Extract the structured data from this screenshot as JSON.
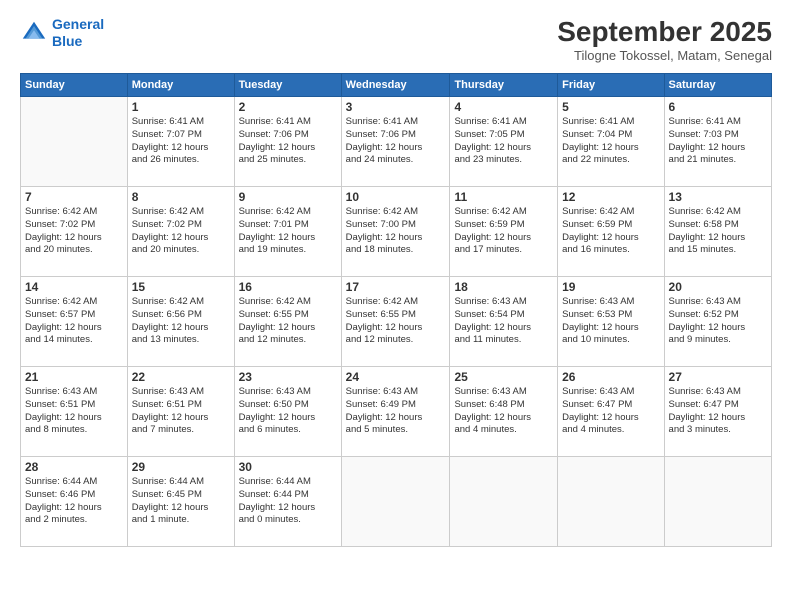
{
  "header": {
    "logo_line1": "General",
    "logo_line2": "Blue",
    "month": "September 2025",
    "location": "Tilogne Tokossel, Matam, Senegal"
  },
  "weekdays": [
    "Sunday",
    "Monday",
    "Tuesday",
    "Wednesday",
    "Thursday",
    "Friday",
    "Saturday"
  ],
  "weeks": [
    [
      {
        "day": "",
        "info": ""
      },
      {
        "day": "1",
        "info": "Sunrise: 6:41 AM\nSunset: 7:07 PM\nDaylight: 12 hours\nand 26 minutes."
      },
      {
        "day": "2",
        "info": "Sunrise: 6:41 AM\nSunset: 7:06 PM\nDaylight: 12 hours\nand 25 minutes."
      },
      {
        "day": "3",
        "info": "Sunrise: 6:41 AM\nSunset: 7:06 PM\nDaylight: 12 hours\nand 24 minutes."
      },
      {
        "day": "4",
        "info": "Sunrise: 6:41 AM\nSunset: 7:05 PM\nDaylight: 12 hours\nand 23 minutes."
      },
      {
        "day": "5",
        "info": "Sunrise: 6:41 AM\nSunset: 7:04 PM\nDaylight: 12 hours\nand 22 minutes."
      },
      {
        "day": "6",
        "info": "Sunrise: 6:41 AM\nSunset: 7:03 PM\nDaylight: 12 hours\nand 21 minutes."
      }
    ],
    [
      {
        "day": "7",
        "info": "Sunrise: 6:42 AM\nSunset: 7:02 PM\nDaylight: 12 hours\nand 20 minutes."
      },
      {
        "day": "8",
        "info": "Sunrise: 6:42 AM\nSunset: 7:02 PM\nDaylight: 12 hours\nand 20 minutes."
      },
      {
        "day": "9",
        "info": "Sunrise: 6:42 AM\nSunset: 7:01 PM\nDaylight: 12 hours\nand 19 minutes."
      },
      {
        "day": "10",
        "info": "Sunrise: 6:42 AM\nSunset: 7:00 PM\nDaylight: 12 hours\nand 18 minutes."
      },
      {
        "day": "11",
        "info": "Sunrise: 6:42 AM\nSunset: 6:59 PM\nDaylight: 12 hours\nand 17 minutes."
      },
      {
        "day": "12",
        "info": "Sunrise: 6:42 AM\nSunset: 6:59 PM\nDaylight: 12 hours\nand 16 minutes."
      },
      {
        "day": "13",
        "info": "Sunrise: 6:42 AM\nSunset: 6:58 PM\nDaylight: 12 hours\nand 15 minutes."
      }
    ],
    [
      {
        "day": "14",
        "info": "Sunrise: 6:42 AM\nSunset: 6:57 PM\nDaylight: 12 hours\nand 14 minutes."
      },
      {
        "day": "15",
        "info": "Sunrise: 6:42 AM\nSunset: 6:56 PM\nDaylight: 12 hours\nand 13 minutes."
      },
      {
        "day": "16",
        "info": "Sunrise: 6:42 AM\nSunset: 6:55 PM\nDaylight: 12 hours\nand 12 minutes."
      },
      {
        "day": "17",
        "info": "Sunrise: 6:42 AM\nSunset: 6:55 PM\nDaylight: 12 hours\nand 12 minutes."
      },
      {
        "day": "18",
        "info": "Sunrise: 6:43 AM\nSunset: 6:54 PM\nDaylight: 12 hours\nand 11 minutes."
      },
      {
        "day": "19",
        "info": "Sunrise: 6:43 AM\nSunset: 6:53 PM\nDaylight: 12 hours\nand 10 minutes."
      },
      {
        "day": "20",
        "info": "Sunrise: 6:43 AM\nSunset: 6:52 PM\nDaylight: 12 hours\nand 9 minutes."
      }
    ],
    [
      {
        "day": "21",
        "info": "Sunrise: 6:43 AM\nSunset: 6:51 PM\nDaylight: 12 hours\nand 8 minutes."
      },
      {
        "day": "22",
        "info": "Sunrise: 6:43 AM\nSunset: 6:51 PM\nDaylight: 12 hours\nand 7 minutes."
      },
      {
        "day": "23",
        "info": "Sunrise: 6:43 AM\nSunset: 6:50 PM\nDaylight: 12 hours\nand 6 minutes."
      },
      {
        "day": "24",
        "info": "Sunrise: 6:43 AM\nSunset: 6:49 PM\nDaylight: 12 hours\nand 5 minutes."
      },
      {
        "day": "25",
        "info": "Sunrise: 6:43 AM\nSunset: 6:48 PM\nDaylight: 12 hours\nand 4 minutes."
      },
      {
        "day": "26",
        "info": "Sunrise: 6:43 AM\nSunset: 6:47 PM\nDaylight: 12 hours\nand 4 minutes."
      },
      {
        "day": "27",
        "info": "Sunrise: 6:43 AM\nSunset: 6:47 PM\nDaylight: 12 hours\nand 3 minutes."
      }
    ],
    [
      {
        "day": "28",
        "info": "Sunrise: 6:44 AM\nSunset: 6:46 PM\nDaylight: 12 hours\nand 2 minutes."
      },
      {
        "day": "29",
        "info": "Sunrise: 6:44 AM\nSunset: 6:45 PM\nDaylight: 12 hours\nand 1 minute."
      },
      {
        "day": "30",
        "info": "Sunrise: 6:44 AM\nSunset: 6:44 PM\nDaylight: 12 hours\nand 0 minutes."
      },
      {
        "day": "",
        "info": ""
      },
      {
        "day": "",
        "info": ""
      },
      {
        "day": "",
        "info": ""
      },
      {
        "day": "",
        "info": ""
      }
    ]
  ]
}
